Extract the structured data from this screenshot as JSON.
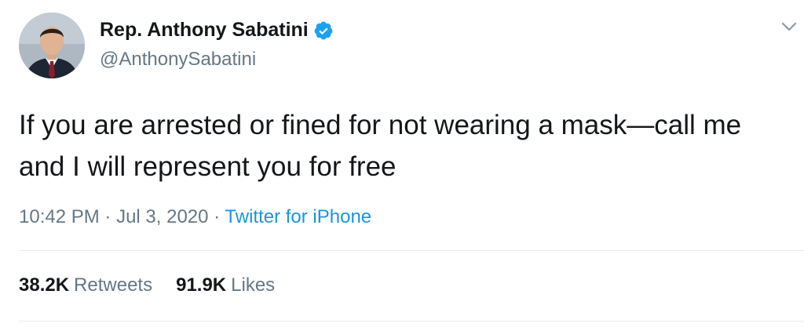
{
  "author": {
    "display_name": "Rep. Anthony Sabatini",
    "handle": "@AnthonySabatini",
    "verified": true,
    "avatar_icon": "profile-photo"
  },
  "tweet": {
    "text": "If you are arrested or fined for not wearing a mask—call me and I will represent you for free",
    "time": "10:42 PM",
    "date": "Jul 3, 2020",
    "separator": "·",
    "source": "Twitter for iPhone"
  },
  "stats": {
    "retweets_count": "38.2K",
    "retweets_label": "Retweets",
    "likes_count": "91.9K",
    "likes_label": "Likes"
  },
  "colors": {
    "text_primary": "#14171a",
    "text_secondary": "#657786",
    "link": "#1b95e0",
    "verified_badge": "#1da1f2",
    "divider": "#e6ecf0"
  },
  "icons": {
    "verified": "verified-badge-icon",
    "menu": "chevron-down-icon"
  }
}
